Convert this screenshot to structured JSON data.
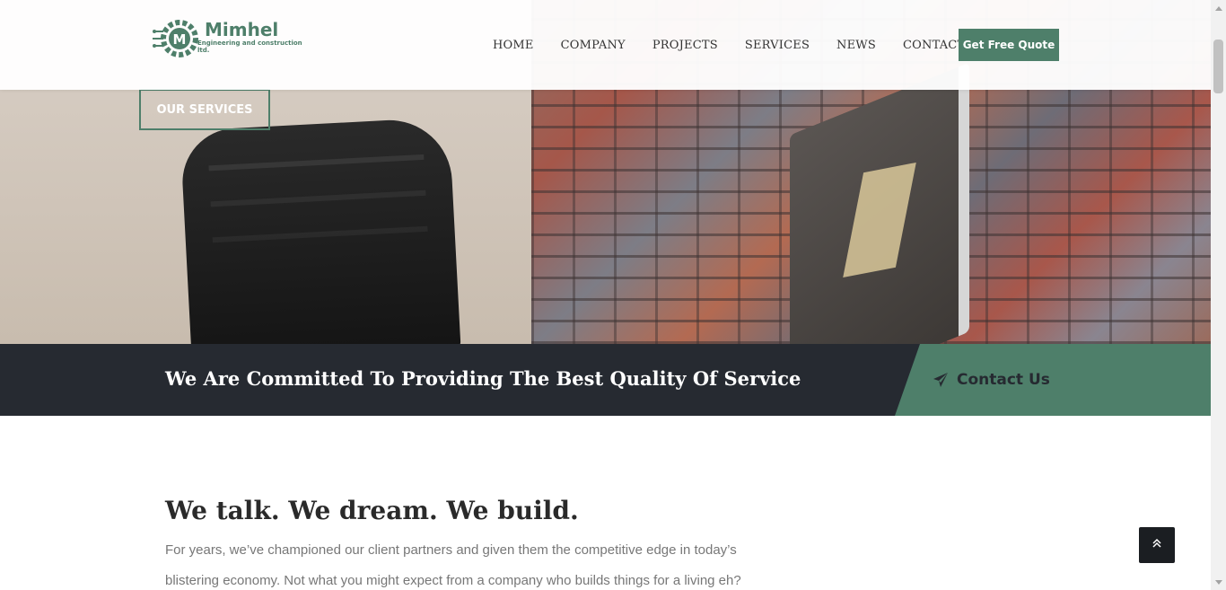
{
  "header": {
    "logo_name": "Mimhel",
    "logo_tagline": "Engineering and construction ltd.",
    "nav": [
      {
        "label": "HOME"
      },
      {
        "label": "COMPANY"
      },
      {
        "label": "PROJECTS"
      },
      {
        "label": "SERVICES"
      },
      {
        "label": "NEWS"
      },
      {
        "label": "CONTACT"
      }
    ],
    "quote_label": "Get Free Quote"
  },
  "hero": {
    "services_button": "OUR SERVICES"
  },
  "banner": {
    "title": "We Are Committed To Providing The Best Quality Of Service",
    "cta_label": "Contact Us",
    "cta_icon": "paper-plane-icon"
  },
  "about": {
    "heading": "We talk. We dream. We build.",
    "text": "For years, we’ve championed our client partners and given them the competitive edge in today’s blistering economy. Not what you might expect from a company who builds things for a living eh?"
  },
  "ui": {
    "back_to_top_icon": "double-chevron-up-icon"
  },
  "colors": {
    "brand": "#4e7f6a",
    "dark": "#262a31"
  }
}
